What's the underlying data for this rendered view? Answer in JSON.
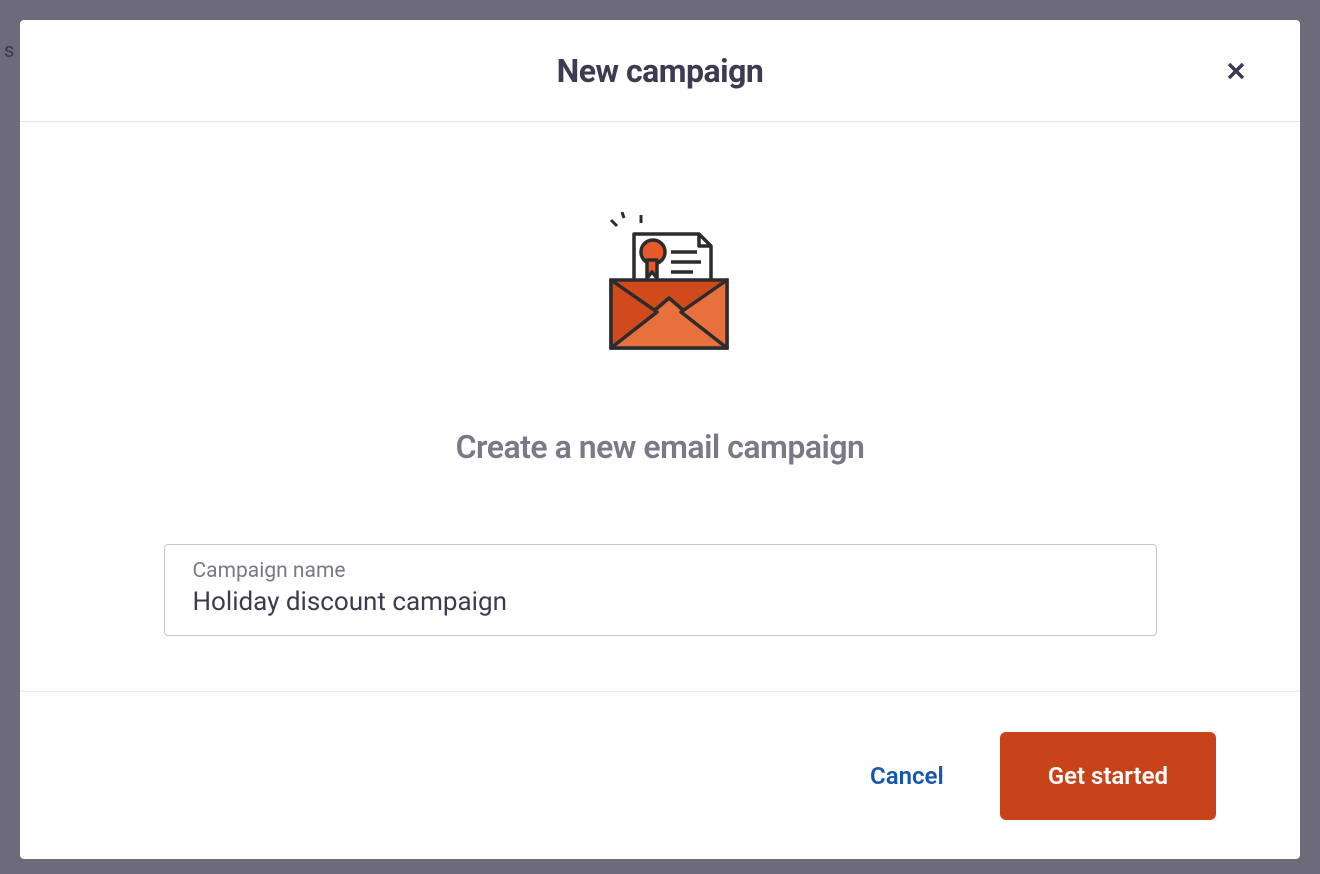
{
  "modal": {
    "title": "New campaign",
    "subtitle": "Create a new email campaign",
    "input": {
      "label": "Campaign name",
      "value": "Holiday discount campaign"
    },
    "footer": {
      "cancel_label": "Cancel",
      "primary_label": "Get started"
    }
  },
  "colors": {
    "primary": "#c9431a",
    "link": "#1756b3",
    "text_dark": "#3e3a52",
    "text_muted": "#7b7888",
    "border": "#e6e6e6",
    "backdrop": "#6d6b7a"
  }
}
